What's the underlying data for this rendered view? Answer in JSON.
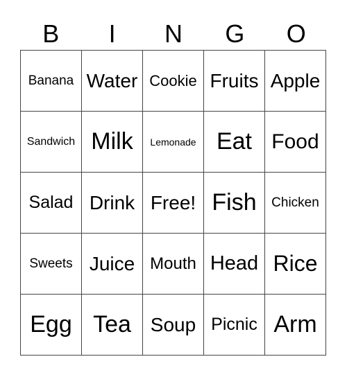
{
  "header": [
    "B",
    "I",
    "N",
    "G",
    "O"
  ],
  "cells": [
    [
      {
        "t": "Banana",
        "s": 19
      },
      {
        "t": "Water",
        "s": 28
      },
      {
        "t": "Cookie",
        "s": 22
      },
      {
        "t": "Fruits",
        "s": 28
      },
      {
        "t": "Apple",
        "s": 28
      }
    ],
    [
      {
        "t": "Sandwich",
        "s": 16
      },
      {
        "t": "Milk",
        "s": 34
      },
      {
        "t": "Lemonade",
        "s": 14
      },
      {
        "t": "Eat",
        "s": 34
      },
      {
        "t": "Food",
        "s": 30
      }
    ],
    [
      {
        "t": "Salad",
        "s": 25
      },
      {
        "t": "Drink",
        "s": 28
      },
      {
        "t": "Free!",
        "s": 28
      },
      {
        "t": "Fish",
        "s": 34
      },
      {
        "t": "Chicken",
        "s": 19
      }
    ],
    [
      {
        "t": "Sweets",
        "s": 19
      },
      {
        "t": "Juice",
        "s": 28
      },
      {
        "t": "Mouth",
        "s": 24
      },
      {
        "t": "Head",
        "s": 29
      },
      {
        "t": "Rice",
        "s": 32
      }
    ],
    [
      {
        "t": "Egg",
        "s": 34
      },
      {
        "t": "Tea",
        "s": 34
      },
      {
        "t": "Soup",
        "s": 28
      },
      {
        "t": "Picnic",
        "s": 25
      },
      {
        "t": "Arm",
        "s": 34
      }
    ]
  ]
}
